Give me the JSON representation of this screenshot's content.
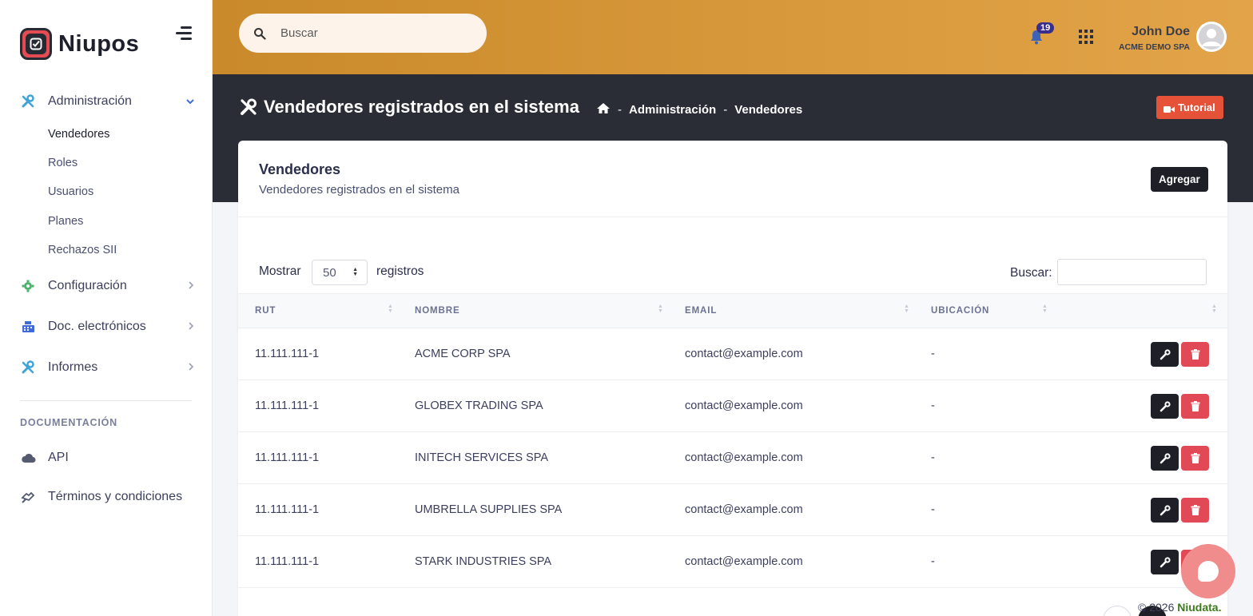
{
  "brand": {
    "name": "Niupos"
  },
  "sidebar": {
    "items": [
      {
        "label": "Administración",
        "icon": "tools-icon"
      },
      {
        "label": "Configuración",
        "icon": "gear-icon"
      },
      {
        "label": "Doc. electrónicos",
        "icon": "cash-register-icon"
      },
      {
        "label": "Informes",
        "icon": "tools-icon"
      }
    ],
    "subitems": [
      "Vendedores",
      "Roles",
      "Usuarios",
      "Planes",
      "Rechazos SII"
    ],
    "section_title": "DOCUMENTACIÓN",
    "doc_items": [
      {
        "label": "API",
        "icon": "cloud-icon"
      },
      {
        "label": "Términos y condiciones",
        "icon": "handshake-icon"
      }
    ]
  },
  "header": {
    "search_placeholder": "Buscar",
    "notifications_count": "19",
    "user_name": "John Doe",
    "user_company": "ACME DEMO SPA"
  },
  "page": {
    "title": "Vendedores registrados en el sistema",
    "breadcrumb": [
      "Administración",
      "Vendedores"
    ],
    "tutorial_label": "Tutorial"
  },
  "card": {
    "title": "Vendedores",
    "subtitle": "Vendedores registrados en el sistema",
    "add_label": "Agregar",
    "show_label": "Mostrar",
    "page_size": "50",
    "records_label": "registros",
    "search_label": "Buscar:"
  },
  "table": {
    "columns": [
      "RUT",
      "NOMBRE",
      "EMAIL",
      "UBICACIÓN"
    ],
    "rows": [
      {
        "rut": "11.111.111-1",
        "nombre": "ACME CORP SPA",
        "email": "contact@example.com",
        "ubicacion": "-"
      },
      {
        "rut": "11.111.111-1",
        "nombre": "GLOBEX TRADING SPA",
        "email": "contact@example.com",
        "ubicacion": "-"
      },
      {
        "rut": "11.111.111-1",
        "nombre": "INITECH SERVICES SPA",
        "email": "contact@example.com",
        "ubicacion": "-"
      },
      {
        "rut": "11.111.111-1",
        "nombre": "UMBRELLA SUPPLIES SPA",
        "email": "contact@example.com",
        "ubicacion": "-"
      },
      {
        "rut": "11.111.111-1",
        "nombre": "STARK INDUSTRIES SPA",
        "email": "contact@example.com",
        "ubicacion": "-"
      }
    ]
  },
  "footer": {
    "copyright": "© 2026",
    "company": "Niudata."
  },
  "colors": {
    "accent": "#e3a449",
    "dark": "#2b2d36",
    "danger": "#e14956",
    "tutorial": "#e65238"
  }
}
